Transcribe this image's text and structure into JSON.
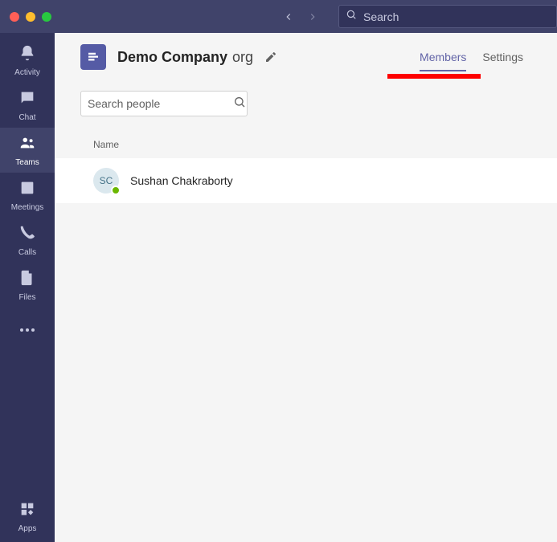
{
  "titlebar": {
    "search_placeholder": "Search"
  },
  "rail": {
    "items": [
      {
        "id": "activity",
        "label": "Activity"
      },
      {
        "id": "chat",
        "label": "Chat"
      },
      {
        "id": "teams",
        "label": "Teams"
      },
      {
        "id": "meetings",
        "label": "Meetings"
      },
      {
        "id": "calls",
        "label": "Calls"
      },
      {
        "id": "files",
        "label": "Files"
      }
    ],
    "apps_label": "Apps"
  },
  "header": {
    "org_name_bold": "Demo Company",
    "org_name_suffix": "org"
  },
  "tabs": {
    "members": "Members",
    "settings": "Settings"
  },
  "search_people": {
    "placeholder": "Search people"
  },
  "table": {
    "col_name": "Name"
  },
  "members": [
    {
      "initials": "SC",
      "name": "Sushan Chakraborty",
      "presence": "available"
    }
  ]
}
